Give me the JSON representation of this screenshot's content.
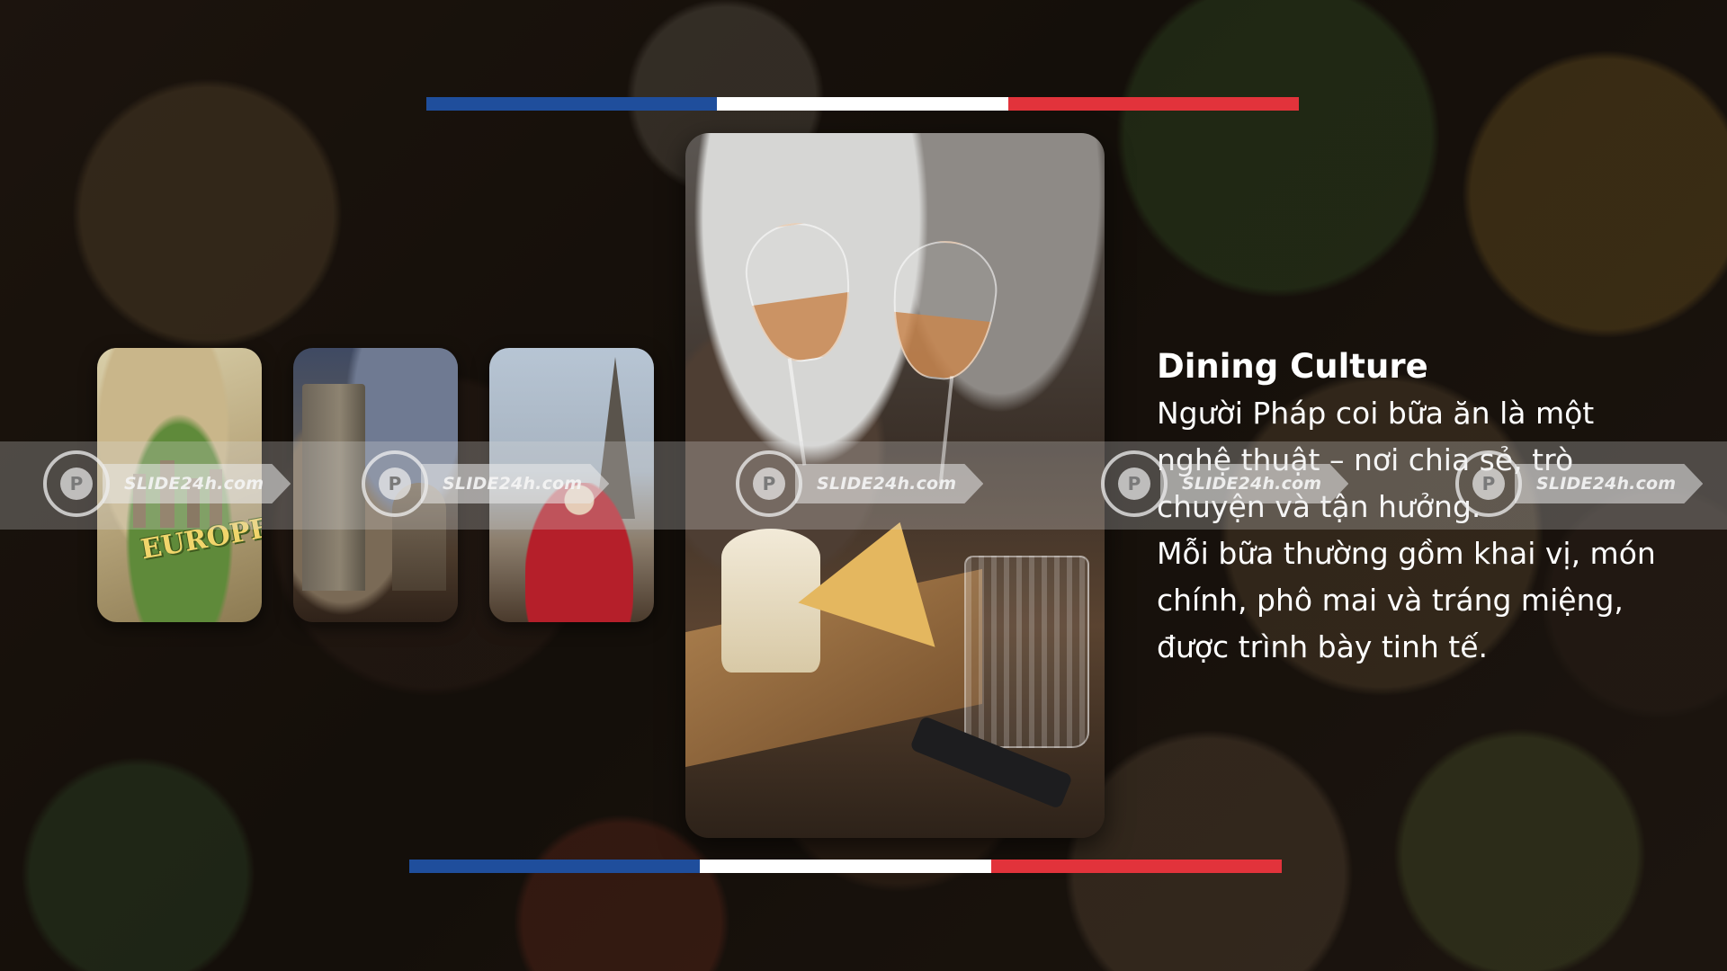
{
  "slide": {
    "flag_colors": [
      "#1f4e9c",
      "#ffffff",
      "#e2333b"
    ],
    "thumbnails": [
      {
        "label": "EUROPE",
        "icon": "europe-map-image"
      },
      {
        "label": "",
        "icon": "historic-ruins-image"
      },
      {
        "label": "",
        "icon": "eiffel-tower-dancer-image"
      }
    ],
    "main_image": {
      "icon": "wine-cheese-dining-image"
    },
    "heading": "Dining Culture",
    "paragraph_1": "Người Pháp coi bữa ăn là một nghệ thuật – nơi chia sẻ, trò chuyện và tận hưởng.",
    "paragraph_2": "Mỗi bữa thường gồm khai vị, món chính, phô mai và tráng miệng, được trình bày tinh tế."
  },
  "watermark": {
    "text": "SLIDE24h.com",
    "logo_letter": "P"
  }
}
